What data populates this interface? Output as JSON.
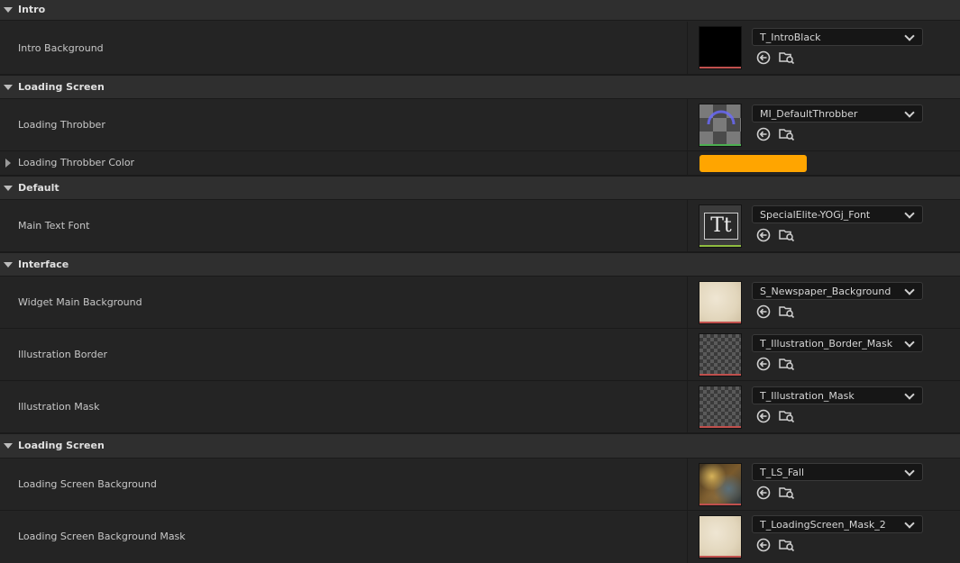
{
  "colors": {
    "panel_bg": "#242424",
    "category_bg": "#2f2f2f",
    "throbber_color": "#ffa500",
    "texture_bar": "#c0504d",
    "material_bar": "#4caf50",
    "font_bar": "#8fbc3f"
  },
  "icons": {
    "use_selected": "arrow-left-in-circle-icon",
    "browse": "folder-search-icon",
    "category_toggle": "triangle-down-icon",
    "row_expander": "triangle-right-icon"
  },
  "sections": [
    {
      "category": "Intro",
      "rows": [
        {
          "label": "Intro Background",
          "value": "T_IntroBlack",
          "thumb": "black"
        }
      ]
    },
    {
      "category": "Loading Screen",
      "rows": [
        {
          "label": "Loading Throbber",
          "value": "MI_DefaultThrobber",
          "thumb": "material"
        },
        {
          "label": "Loading Throbber Color",
          "color": "#ffa500"
        }
      ]
    },
    {
      "category": "Default",
      "rows": [
        {
          "label": "Main Text Font",
          "value": "SpecialElite-YOGj_Font",
          "thumb": "font"
        }
      ]
    },
    {
      "category": "Interface",
      "rows": [
        {
          "label": "Widget Main Background",
          "value": "S_Newspaper_Background",
          "thumb": "paper"
        },
        {
          "label": "Illustration Border",
          "value": "T_Illustration_Border_Mask",
          "thumb": "checker"
        },
        {
          "label": "Illustration Mask",
          "value": "T_Illustration_Mask",
          "thumb": "checker"
        }
      ]
    },
    {
      "category": "Loading Screen",
      "rows": [
        {
          "label": "Loading Screen Background",
          "value": "T_LS_Fall",
          "thumb": "fall"
        },
        {
          "label": "Loading Screen Background Mask",
          "value": "T_LoadingScreen_Mask_2",
          "thumb": "paper"
        }
      ]
    }
  ]
}
